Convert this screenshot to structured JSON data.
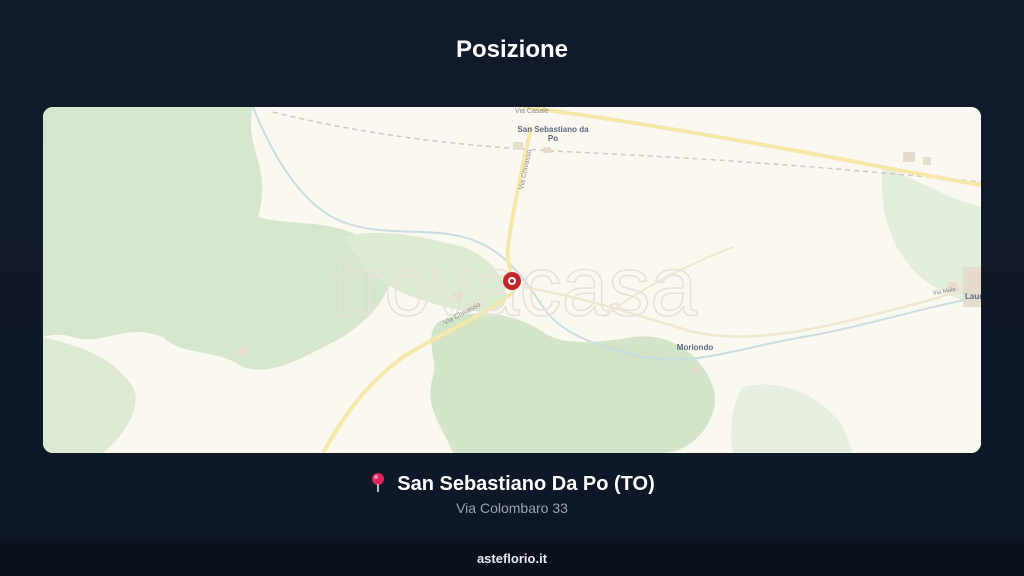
{
  "header": {
    "title": "Posizione"
  },
  "map": {
    "watermark": "trovacasa",
    "labels": {
      "town_line1": "San Sebastiano da",
      "town_line2": "Po",
      "road_casale": "Via Casale",
      "road_chivasso_north": "Via Chivasso",
      "road_chivasso_south": "Via Chivasso",
      "moriondo": "Moriondo",
      "road_mole": "Via Mole",
      "edge_town": "Laur"
    },
    "colors": {
      "marker": "#c4252b",
      "green": "#d6e6cd",
      "background": "#fbf7f1"
    }
  },
  "location": {
    "pin_icon": "round-pushpin",
    "name": "San Sebastiano Da Po (TO)",
    "address": "Via Colombaro 33"
  },
  "footer": {
    "site": "asteflorio.it"
  }
}
